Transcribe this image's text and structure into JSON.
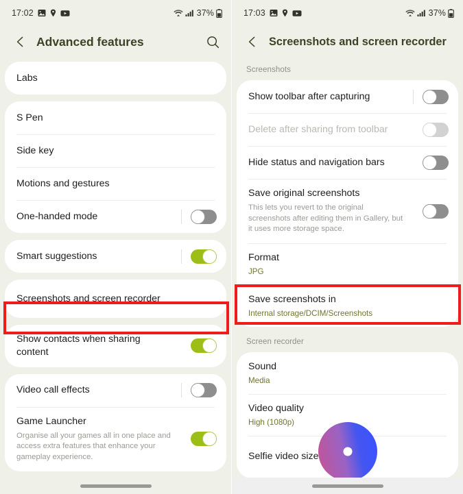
{
  "left": {
    "status_bar": {
      "time": "17:02",
      "icons": [
        "photo-icon",
        "location-icon",
        "youtube-icon"
      ],
      "wifi": "wifi-icon",
      "signal": "signal-icon",
      "battery_percent": "37%",
      "battery": "battery-icon"
    },
    "header": {
      "back": "back-arrow-icon",
      "title": "Advanced features",
      "search": "search-icon"
    },
    "groups": [
      {
        "rows": [
          {
            "title": "Labs",
            "toggle": null
          }
        ]
      },
      {
        "rows": [
          {
            "title": "S Pen",
            "toggle": null
          },
          {
            "title": "Side key",
            "toggle": null
          },
          {
            "title": "Motions and gestures",
            "toggle": null
          },
          {
            "title": "One-handed mode",
            "toggle": "off"
          }
        ]
      },
      {
        "rows": [
          {
            "title": "Smart suggestions",
            "toggle": "on"
          }
        ]
      },
      {
        "highlighted": true,
        "rows": [
          {
            "title": "Screenshots and screen recorder",
            "toggle": null
          }
        ]
      },
      {
        "rows": [
          {
            "title": "Show contacts when sharing content",
            "toggle": "on"
          }
        ]
      },
      {
        "rows": [
          {
            "title": "Video call effects",
            "toggle": "off"
          },
          {
            "title": "Game Launcher",
            "desc": "Organise all your games all in one place and access extra features that enhance your gameplay experience.",
            "toggle": "on"
          }
        ]
      }
    ]
  },
  "right": {
    "status_bar": {
      "time": "17:03",
      "icons": [
        "photo-icon",
        "location-icon",
        "youtube-icon"
      ],
      "wifi": "wifi-icon",
      "signal": "signal-icon",
      "battery_percent": "37%",
      "battery": "battery-icon"
    },
    "header": {
      "back": "back-arrow-icon",
      "title": "Screenshots and screen recorder"
    },
    "sections": [
      {
        "label": "Screenshots",
        "groups": [
          {
            "rows": [
              {
                "title": "Show toolbar after capturing",
                "toggle": "off",
                "separator": true
              },
              {
                "title": "Delete after sharing from toolbar",
                "toggle": "off-disabled",
                "dim": true
              },
              {
                "title": "Hide status and navigation bars",
                "toggle": "off"
              },
              {
                "title": "Save original screenshots",
                "desc": "This lets you revert to the original screenshots after editing them in Gallery, but it uses more storage space.",
                "toggle": "off"
              },
              {
                "title": "Format",
                "sub": "JPG"
              },
              {
                "title": "Save screenshots in",
                "sub": "Internal storage/DCIM/Screenshots",
                "highlighted": true
              }
            ]
          }
        ]
      },
      {
        "label": "Screen recorder",
        "groups": [
          {
            "rows": [
              {
                "title": "Sound",
                "sub": "Media"
              },
              {
                "title": "Video quality",
                "sub": "High (1080p)"
              },
              {
                "title": "Selfie video size"
              }
            ]
          }
        ]
      }
    ]
  },
  "colors": {
    "accent_green": "#9cbe17",
    "title_olive": "#3c4224",
    "sub_olive": "#71752e",
    "highlight_red": "#ee1c1c",
    "page_bg": "#eff0e8",
    "card_bg": "#ffffff"
  }
}
